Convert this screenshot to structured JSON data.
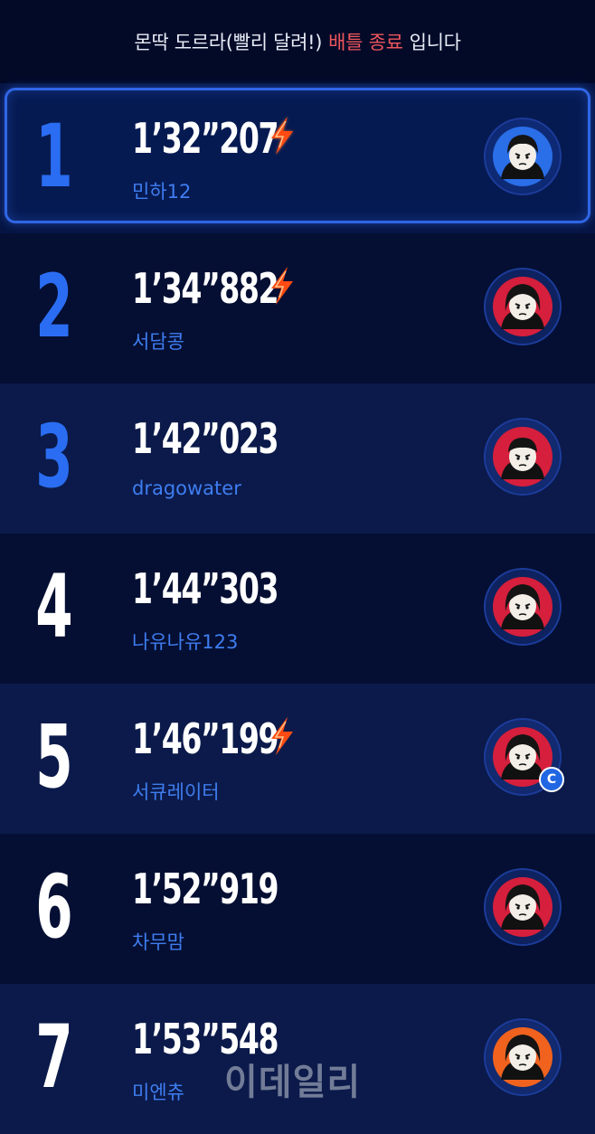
{
  "header": {
    "prefix": "몬딱 도르라(빨리 달려!)",
    "status": "배틀 종료",
    "suffix": "입니다"
  },
  "colors": {
    "background": "#020a26",
    "rank_top3": "#2a6df2",
    "rank_other": "#ffffff",
    "name": "#3f7df0",
    "status_accent": "#f0565c",
    "highlight_border": "#2f66e6",
    "bolt": "#ff5a1a"
  },
  "rows": [
    {
      "rank": "1",
      "time": "1’32”207",
      "name": "민하12",
      "bolt": true,
      "avatar_icon": "avatar-blue-icon",
      "badge": ""
    },
    {
      "rank": "2",
      "time": "1’34”882",
      "name": "서담콩",
      "bolt": true,
      "avatar_icon": "avatar-red-icon",
      "badge": ""
    },
    {
      "rank": "3",
      "time": "1’42”023",
      "name": "dragowater",
      "bolt": false,
      "avatar_icon": "avatar-red-icon",
      "badge": ""
    },
    {
      "rank": "4",
      "time": "1’44”303",
      "name": "나유나유123",
      "bolt": false,
      "avatar_icon": "avatar-red-icon",
      "badge": ""
    },
    {
      "rank": "5",
      "time": "1’46”199",
      "name": "서큐레이터",
      "bolt": true,
      "avatar_icon": "avatar-red-icon",
      "badge": "C"
    },
    {
      "rank": "6",
      "time": "1’52”919",
      "name": "차무맘",
      "bolt": false,
      "avatar_icon": "avatar-red-icon",
      "badge": ""
    },
    {
      "rank": "7",
      "time": "1’53”548",
      "name": "미엔츄",
      "bolt": false,
      "avatar_icon": "avatar-orange-icon",
      "badge": ""
    }
  ],
  "watermark": "이데일리"
}
